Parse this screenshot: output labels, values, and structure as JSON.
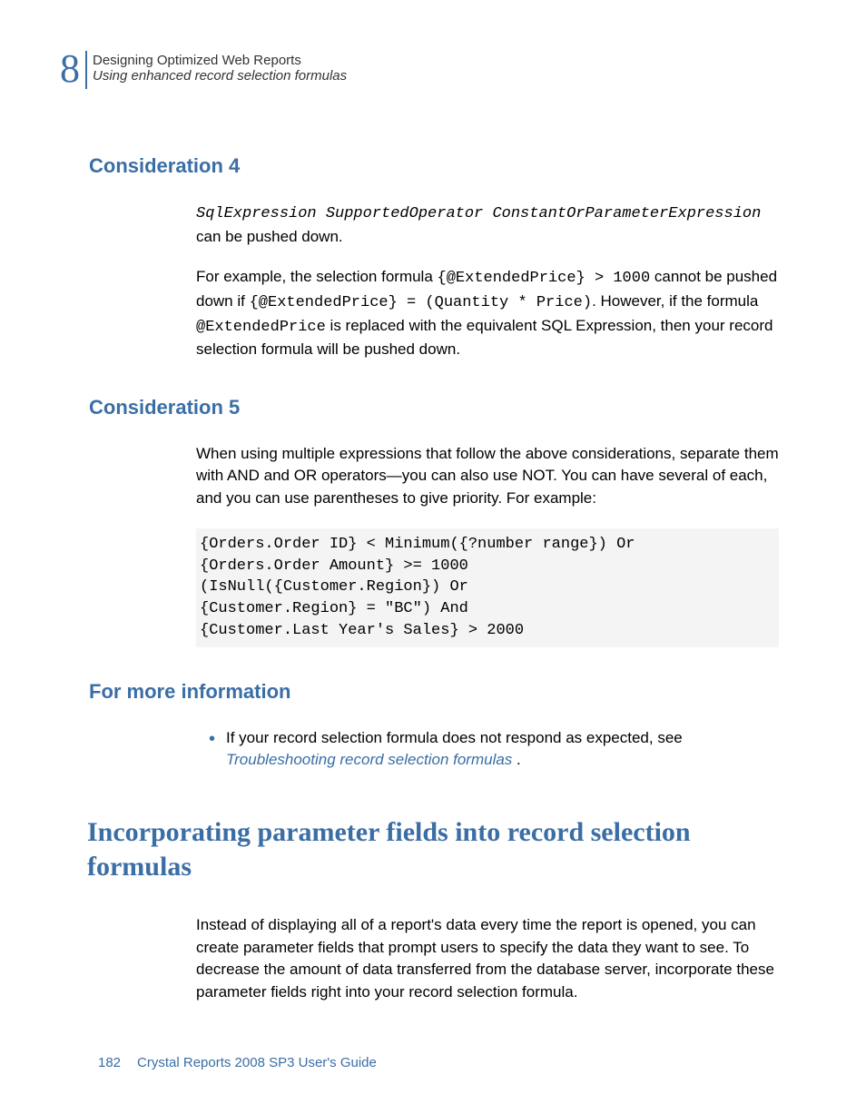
{
  "header": {
    "chapter_number": "8",
    "line1": "Designing Optimized Web Reports",
    "line2": "Using enhanced record selection formulas"
  },
  "c4": {
    "title": "Consideration 4",
    "expr_italic": "SqlExpression SupportedOperator ConstantOrParameterExpression",
    "expr_tail": " can be pushed down.",
    "p2_a": "For example, the selection formula ",
    "p2_code1": "{@ExtendedPrice} > 1000",
    "p2_b": " cannot be pushed down if ",
    "p2_code2": "{@ExtendedPrice} = (Quantity * Price)",
    "p2_c": ". However, if the formula ",
    "p2_code3": "@ExtendedPrice",
    "p2_d": " is replaced with the equivalent SQL Expression, then your record selection formula will be pushed down."
  },
  "c5": {
    "title": "Consideration 5",
    "p1": "When using multiple expressions that follow the above considerations, separate them with AND and OR operators—you can also use NOT. You can have several of each, and you can use parentheses to give priority. For example:",
    "code": "{Orders.Order ID} < Minimum({?number range}) Or\n{Orders.Order Amount} >= 1000\n(IsNull({Customer.Region}) Or\n{Customer.Region} = \"BC\") And\n{Customer.Last Year's Sales} > 2000"
  },
  "more": {
    "title": "For more information",
    "bullet_a": "If your record selection formula does not respond as expected, see ",
    "bullet_link": "Troubleshooting record selection formulas",
    "bullet_b": " ."
  },
  "h2": "Incorporating parameter fields into record selection formulas",
  "main_p": "Instead of displaying all of a report's data every time the report is opened, you can create parameter fields that prompt users to specify the data they want to see. To decrease the amount of data transferred from the database server, incorporate these parameter fields right into your record selection formula.",
  "footer": {
    "page": "182",
    "doc": "Crystal Reports 2008 SP3 User's Guide"
  }
}
